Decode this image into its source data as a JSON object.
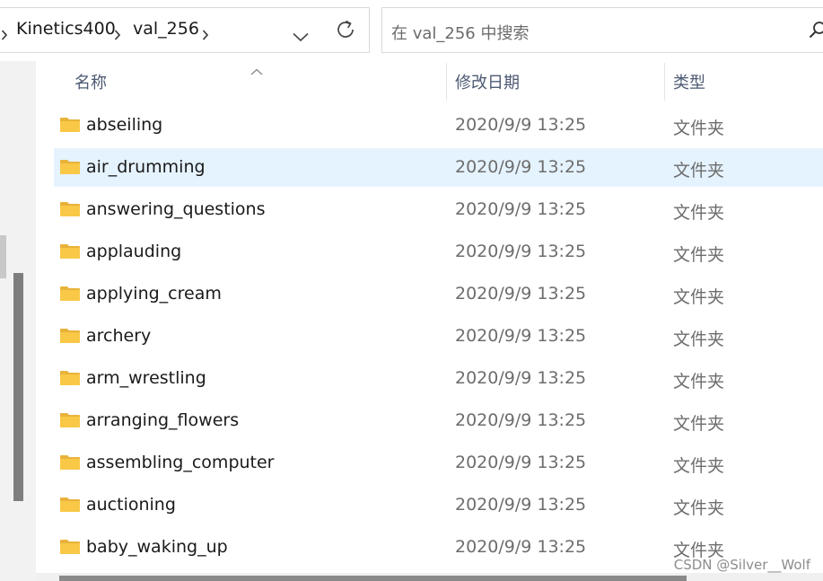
{
  "address": {
    "crumbs": [
      "Kinetics400",
      "val_256"
    ]
  },
  "search": {
    "placeholder": "在 val_256 中搜索"
  },
  "columns": {
    "name": "名称",
    "modified": "修改日期",
    "type": "类型"
  },
  "rows": [
    {
      "name": "abseiling",
      "modified": "2020/9/9 13:25",
      "type": "文件夹"
    },
    {
      "name": "air_drumming",
      "modified": "2020/9/9 13:25",
      "type": "文件夹"
    },
    {
      "name": "answering_questions",
      "modified": "2020/9/9 13:25",
      "type": "文件夹"
    },
    {
      "name": "applauding",
      "modified": "2020/9/9 13:25",
      "type": "文件夹"
    },
    {
      "name": "applying_cream",
      "modified": "2020/9/9 13:25",
      "type": "文件夹"
    },
    {
      "name": "archery",
      "modified": "2020/9/9 13:25",
      "type": "文件夹"
    },
    {
      "name": "arm_wrestling",
      "modified": "2020/9/9 13:25",
      "type": "文件夹"
    },
    {
      "name": "arranging_flowers",
      "modified": "2020/9/9 13:25",
      "type": "文件夹"
    },
    {
      "name": "assembling_computer",
      "modified": "2020/9/9 13:25",
      "type": "文件夹"
    },
    {
      "name": "auctioning",
      "modified": "2020/9/9 13:25",
      "type": "文件夹"
    },
    {
      "name": "baby_waking_up",
      "modified": "2020/9/9 13:25",
      "type": "文件夹"
    }
  ],
  "selected_row_index": 1,
  "watermark": "CSDN @Silver__Wolf",
  "colors": {
    "selection": "#e5f3ff",
    "folder": "#f8c846",
    "header_text": "#4d5a73"
  },
  "icons": {
    "folder": "folder-icon",
    "search": "search-icon",
    "refresh": "refresh-icon",
    "dropdown": "chevron-down-icon",
    "breadcrumb_separator": "chevron-right-icon",
    "sort": "sort-ascending-icon"
  }
}
